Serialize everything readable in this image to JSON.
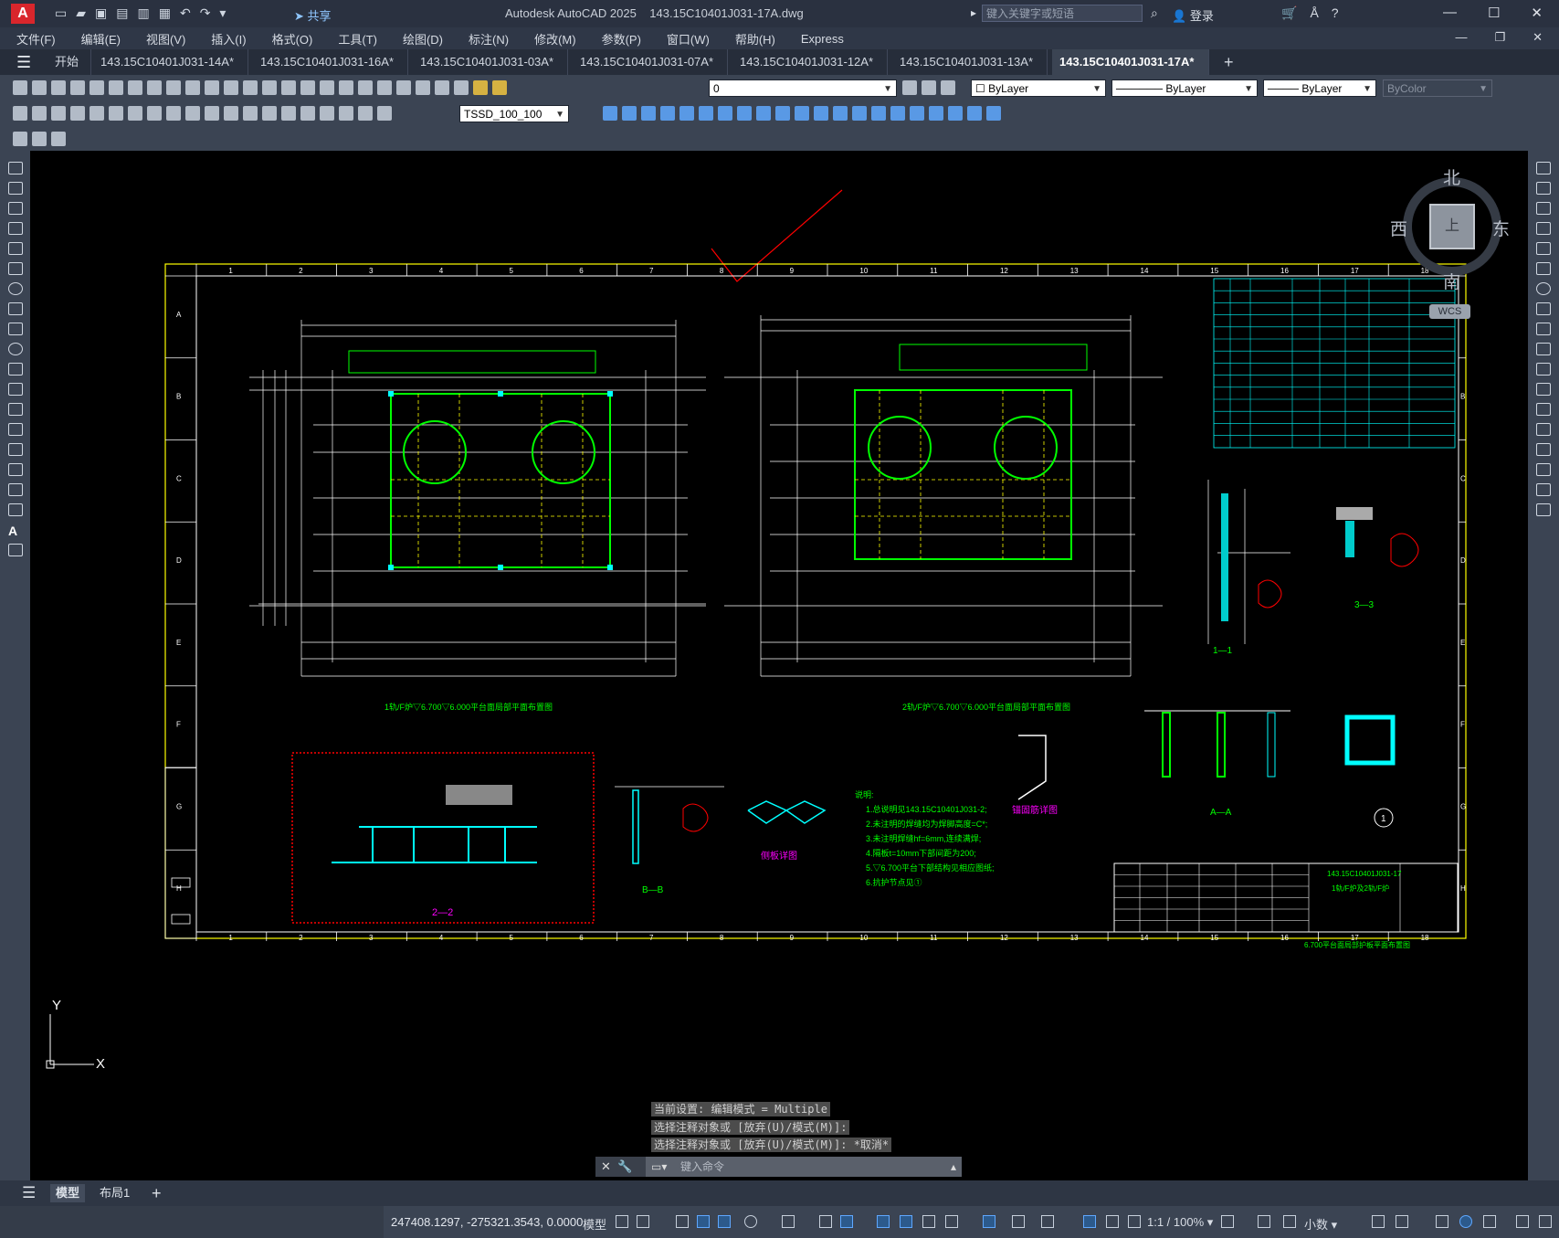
{
  "title_bar": {
    "app_logo": "A",
    "share_label": "共享",
    "app_name": "Autodesk AutoCAD 2025",
    "file_name": "143.15C10401J031-17A.dwg",
    "search_placeholder": "键入关键字或短语",
    "login_label": "登录",
    "window_controls": [
      "—",
      "☐",
      "✕"
    ]
  },
  "menu_bar": {
    "items": [
      "文件(F)",
      "编辑(E)",
      "视图(V)",
      "插入(I)",
      "格式(O)",
      "工具(T)",
      "绘图(D)",
      "标注(N)",
      "修改(M)",
      "参数(P)",
      "窗口(W)",
      "帮助(H)",
      "Express"
    ],
    "doc_controls": [
      "—",
      "❐",
      "✕"
    ]
  },
  "doc_tabs": {
    "items": [
      {
        "label": "开始",
        "active": false
      },
      {
        "label": "143.15C10401J031-14A*",
        "active": false
      },
      {
        "label": "143.15C10401J031-16A*",
        "active": false
      },
      {
        "label": "143.15C10401J031-03A*",
        "active": false
      },
      {
        "label": "143.15C10401J031-07A*",
        "active": false
      },
      {
        "label": "143.15C10401J031-12A*",
        "active": false
      },
      {
        "label": "143.15C10401J031-13A*",
        "active": false
      },
      {
        "label": "143.15C10401J031-17A*",
        "active": true
      }
    ],
    "close_glyph": "✕",
    "add_glyph": "+"
  },
  "toolbar": {
    "layer_value": "0",
    "color_value": "ByLayer",
    "linetype_value": "ByLayer",
    "lineweight_value": "ByLayer",
    "plotstyle_value": "ByColor",
    "dimstyle_value": "TSSD_100_100"
  },
  "view_cube": {
    "north": "北",
    "south": "南",
    "east": "东",
    "west": "西",
    "face": "上",
    "wcs": "WCS"
  },
  "ucs": {
    "y": "Y",
    "x": "X"
  },
  "command_history": [
    "当前设置: 编辑模式 = Multiple",
    "选择注释对象或 [放弃(U)/模式(M)]:",
    "选择注释对象或 [放弃(U)/模式(M)]: *取消*"
  ],
  "command_input_placeholder": "键入命令",
  "layout_tabs": {
    "items": [
      {
        "label": "模型",
        "active": true
      },
      {
        "label": "布局1",
        "active": false
      }
    ],
    "add_glyph": "+"
  },
  "status_bar": {
    "coordinates": "247408.1297, -275321.3543, 0.0000",
    "space": "模型",
    "annotation_scale": "1:1 / 100%",
    "units": "小数"
  },
  "drawing": {
    "plan1_title": "1轨/F炉▽6.700▽6.000平台面局部平面布置图",
    "plan2_title": "2轨/F炉▽6.700▽6.000平台面局部平面布置图",
    "section_22": "2—2",
    "section_11": "1—1",
    "section_33": "3—3",
    "section_aa": "A—A",
    "section_bb": "B—B",
    "detail_side": "侧板详图",
    "detail_anchor": "锚固筋详图",
    "notes_title": "说明:",
    "notes": [
      "1.总说明见143.15C10401J031-2;",
      "2.未注明的焊缝均为焊脚高度=C*;",
      "3.未注明焊缝hf=6mm,连续满焊;",
      "4.隔板t=10mm下部间距为200;",
      "5.▽6.700平台下部结构见相应图纸;",
      "6.抗护节点见①"
    ],
    "drawing_number": "143.15C10401J031-17",
    "title_block_caption": "1轨/F炉及2轨/F炉",
    "sheet_caption": "6.700平台面局部护板平面布置图",
    "detail_circle": "1",
    "column_numbers": [
      "1",
      "2",
      "3",
      "4",
      "5",
      "6",
      "7",
      "8",
      "9",
      "10",
      "11",
      "12",
      "13",
      "14",
      "15",
      "16",
      "17",
      "18"
    ],
    "row_letters": [
      "A",
      "B",
      "C",
      "D",
      "E",
      "F",
      "G",
      "H"
    ]
  },
  "colors": {
    "accent": "#5fa8ff",
    "canvas": "#000000",
    "frame": "#ffff00",
    "structure_green": "#00ff00",
    "cyan": "#00ffff",
    "revision_red": "#ff0000",
    "magenta": "#ff00ff"
  }
}
